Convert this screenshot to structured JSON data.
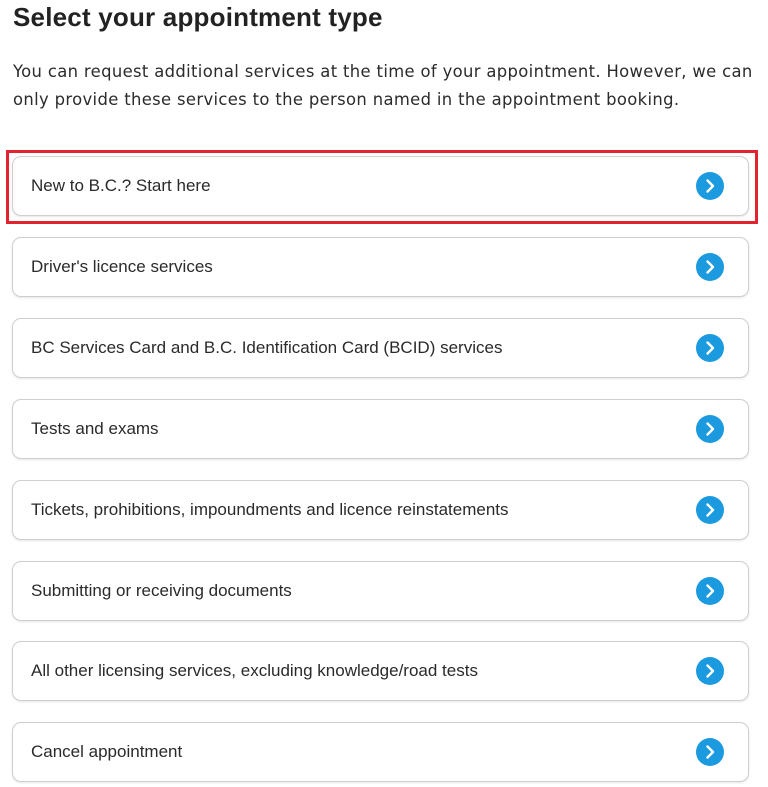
{
  "page": {
    "title": "Select your appointment type",
    "intro": "You can request additional services at the time of your appointment. However, we can only provide these services to the person named in the appointment booking."
  },
  "colors": {
    "accent": "#1b9ae0",
    "highlight": "#e0232f",
    "border": "#cfcfcf"
  },
  "options": [
    {
      "label": "New to B.C.? Start here",
      "icon": "chevron-right-icon",
      "highlighted": true
    },
    {
      "label": "Driver's licence services",
      "icon": "chevron-right-icon"
    },
    {
      "label": "BC Services Card and B.C. Identification Card (BCID) services",
      "icon": "chevron-right-icon"
    },
    {
      "label": "Tests and exams",
      "icon": "chevron-right-icon"
    },
    {
      "label": "Tickets, prohibitions, impoundments and licence reinstatements",
      "icon": "chevron-right-icon"
    },
    {
      "label": "Submitting or receiving documents",
      "icon": "chevron-right-icon"
    },
    {
      "label": "All other licensing services, excluding knowledge/road tests",
      "icon": "chevron-right-icon"
    },
    {
      "label": "Cancel appointment",
      "icon": "chevron-right-icon"
    }
  ]
}
